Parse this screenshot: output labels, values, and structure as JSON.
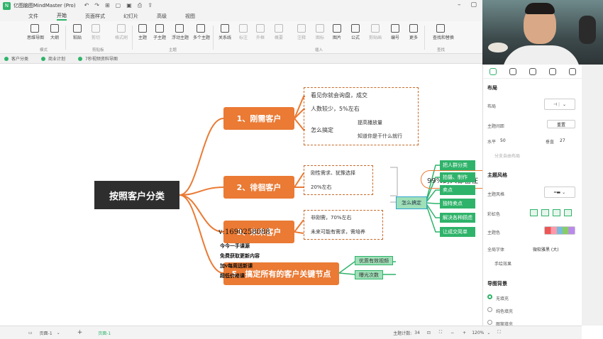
{
  "window": {
    "app_title": "亿图脑图MindMaster (Pro)"
  },
  "menu": [
    "文件",
    "开始",
    "页面样式",
    "幻灯片",
    "高级",
    "视图"
  ],
  "menu_active": 1,
  "ribbon": {
    "buttons": [
      "思维导图",
      "大纲",
      "粘贴",
      "剪切",
      "复制",
      "格式刷",
      "主题",
      "子主题",
      "浮动主题",
      "多个主题",
      "关系线",
      "标注",
      "外框",
      "概要",
      "注释",
      "图标",
      "图片",
      "公式",
      "剪贴画",
      "编号",
      "更多",
      "查找和替换"
    ],
    "groups": [
      "模式",
      "剪贴板",
      "主题",
      "插入",
      "查找"
    ]
  },
  "doc_tabs": [
    "客户分类",
    "商业计划",
    "7秒视频资料导图"
  ],
  "mindmap": {
    "root": "按照客户分类",
    "branches": [
      {
        "label": "1、刚需客户",
        "leaves": [
          "看见你就会询盘，成交",
          "人数较少，5%左右",
          "怎么搞定",
          "提高播放量",
          "知道你是干什么就行"
        ]
      },
      {
        "label": "2、徘徊客户",
        "leaves": [
          "刚性需求、犹豫选择",
          "20%左右"
        ]
      },
      {
        "label": "3、未来客户",
        "leaves": [
          "非刚需，70%左右",
          "未来可能有需求，需培养"
        ]
      },
      {
        "label": "5、搞定所有的客户关键节点",
        "leaves": [
          "优质有效视频",
          "曝光次数"
        ]
      }
    ],
    "summary": "99%的人都留在",
    "how_label": "怎么搞定",
    "how_items": [
      "把人群分类",
      "拍摄、制作",
      "卖点",
      "独特卖点",
      "解决各种顾虑",
      "让成交简单"
    ],
    "watermark_lines": [
      "v:1690258088",
      "今今一手课源",
      "免费获取更新内容",
      "加v每周送新课",
      "超低价格课"
    ]
  },
  "right_panel": {
    "section_layout": "布局",
    "layout_label": "布局",
    "topic_spacing": "主题间距",
    "reset": "重置",
    "h_label": "水平",
    "h_value": "50",
    "v_label": "垂直",
    "v_value": "27",
    "free_layout": "分支自由布局",
    "section_style": "主题风格",
    "style_label": "主题风格",
    "rainbow": "彩虹色",
    "theme_color": "主题色",
    "global_font": "全局字体",
    "font_value": "微软雅黑 (大)",
    "hand_drawn": "手绘效果",
    "section_bg": "导图背景",
    "bg_options": [
      "无填充",
      "纯色填充",
      "图案填充"
    ]
  },
  "status": {
    "page_tab": "页面-1",
    "page_tab_active": "页面-1",
    "topic_count_label": "主题计数:",
    "topic_count": "34",
    "zoom": "120%"
  },
  "colors": {
    "accent": "#2fb36a",
    "branch": "#ea7a34",
    "root": "#2e2e2e"
  }
}
